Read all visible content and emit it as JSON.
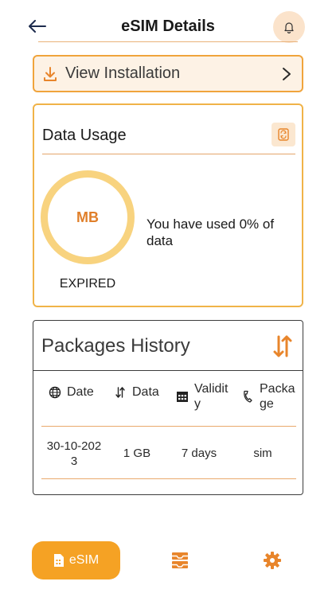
{
  "header": {
    "title": "eSIM Details",
    "back_icon": "arrow-left-icon",
    "bell_icon": "bell-icon"
  },
  "install_button": {
    "label": "View Installation",
    "icon": "download-icon",
    "chevron": "chevron-right-icon"
  },
  "usage": {
    "title": "Data Usage",
    "unit": "MB",
    "status": "EXPIRED",
    "used_text": "You have used 0% of data",
    "used_percent": 0
  },
  "history": {
    "title": "Packages History",
    "columns": [
      {
        "label": "Date",
        "icon": "globe-icon"
      },
      {
        "label": "Data",
        "icon": "up-down-arrows-icon"
      },
      {
        "label": "Validit\ny",
        "icon": "calendar-icon"
      },
      {
        "label": "Packa\nge",
        "icon": "phone-icon"
      }
    ],
    "rows": [
      {
        "date": "30-10-202\n3",
        "data": "1 GB",
        "validity": "7 days",
        "package": "sim"
      }
    ]
  },
  "bottom_nav": {
    "esim_label": "eSIM"
  },
  "colors": {
    "accent": "#f5a224",
    "accent_dark": "#e07f2a",
    "ring": "#f8d37f"
  }
}
